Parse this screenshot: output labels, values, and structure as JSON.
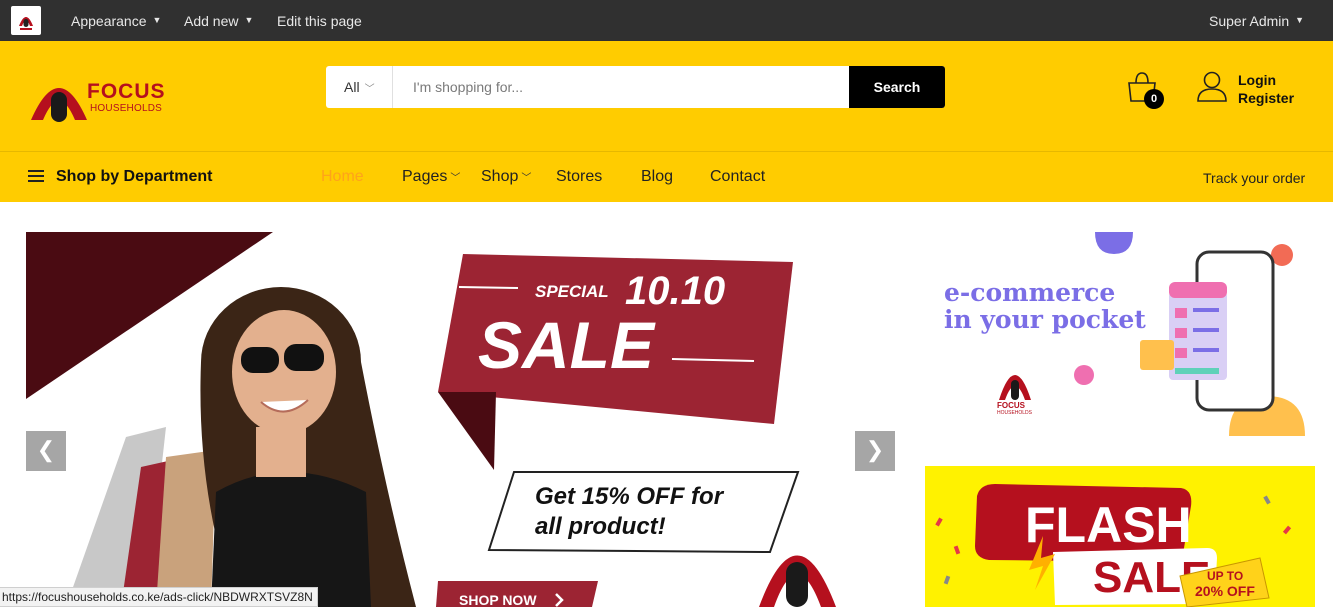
{
  "adminbar": {
    "appearance": "Appearance",
    "add_new": "Add new",
    "edit_page": "Edit this page",
    "user": "Super Admin"
  },
  "brand": {
    "name": "FOCUS",
    "sub": "HOUSEHOLDS"
  },
  "search": {
    "category": "All",
    "placeholder": "I'm shopping for...",
    "button": "Search"
  },
  "cart": {
    "count": "0"
  },
  "account": {
    "login": "Login",
    "register": "Register"
  },
  "nav": {
    "department": "Shop by Department",
    "items": [
      {
        "label": "Home"
      },
      {
        "label": "Pages"
      },
      {
        "label": "Shop"
      },
      {
        "label": "Stores"
      },
      {
        "label": "Blog"
      },
      {
        "label": "Contact"
      }
    ],
    "track": "Track your order"
  },
  "hero": {
    "special": "SPECIAL",
    "date": "10.10",
    "sale": "SALE",
    "offer_line1": "Get 15% OFF for",
    "offer_line2": "all product!",
    "cta": "SHOP NOW"
  },
  "banner1": {
    "line1": "e-commerce",
    "line2": "in your pocket",
    "brand_name": "FOCUS",
    "brand_sub": "HOUSEHOLDS"
  },
  "banner2": {
    "flash": "FLASH",
    "sale": "SALE",
    "upto": "UP TO",
    "percent": "20% OFF"
  },
  "statusbar": {
    "url": "https://focushouseholds.co.ke/ads-click/NBDWRXTSVZ8N"
  },
  "colors": {
    "header": "#ffcc00",
    "adminbar": "#303030",
    "brand_red": "#b5101e",
    "sale_red": "#9c2433",
    "active_nav": "#ffa31a"
  }
}
